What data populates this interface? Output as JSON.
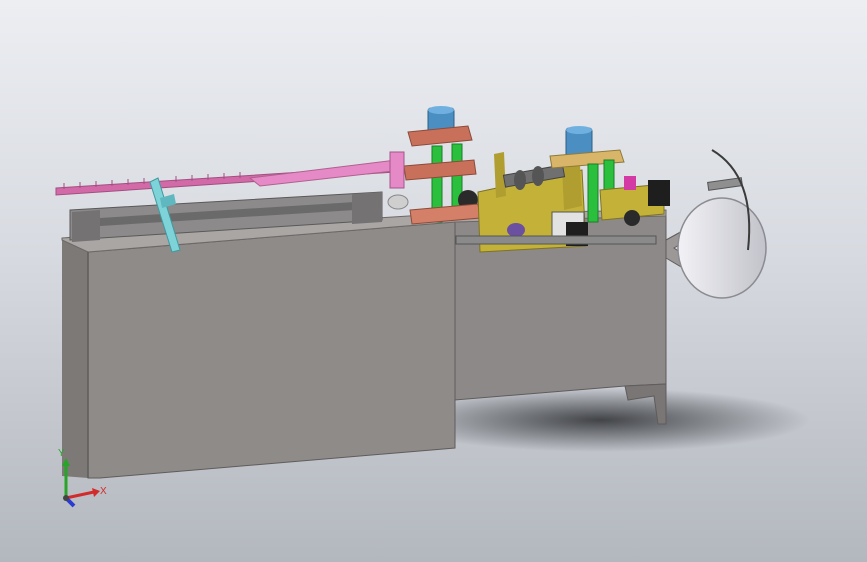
{
  "viewport": {
    "background_top": "#eceef2",
    "background_bottom": "#b3b7be"
  },
  "model": {
    "body_color": "#8f8b89",
    "body_dark": "#6f6b6a",
    "body_light": "#a9a6a4",
    "frame_color": "#c4b238",
    "copper_color": "#c9705a",
    "green_shaft_color": "#2bbf3e",
    "motor_color": "#4b8fc2",
    "pink_arm_color": "#e58ac6",
    "cyan_lever_color": "#7ed3d8",
    "spool_color": "#d8d8de"
  },
  "triad": {
    "x_label": "X",
    "y_label": "Y",
    "x_color": "#d22b2b",
    "y_color": "#28a428",
    "z_color": "#2b3bd2"
  }
}
